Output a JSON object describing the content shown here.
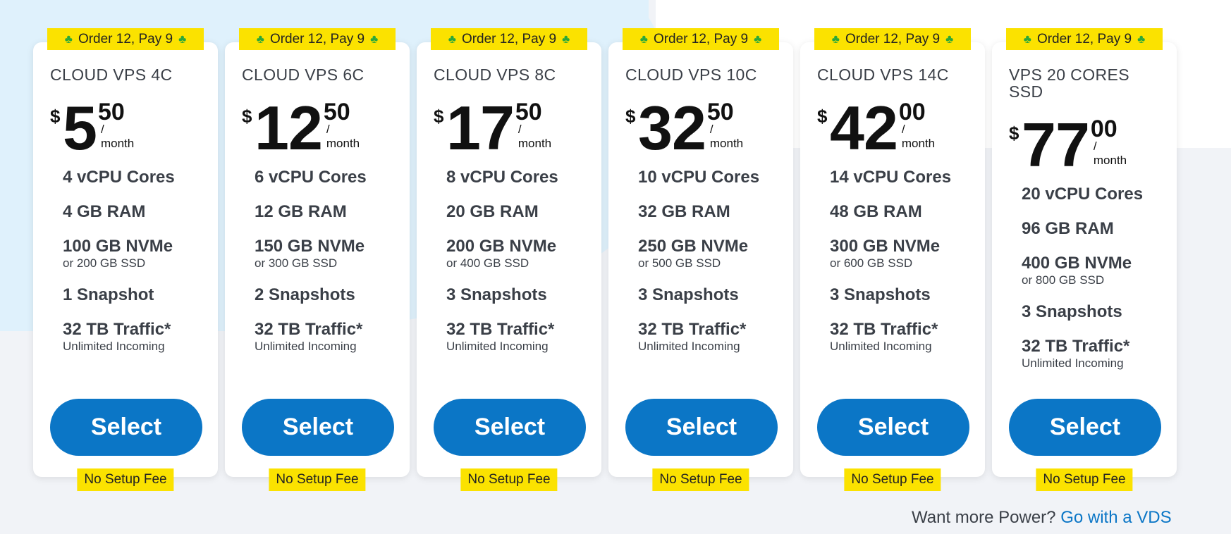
{
  "plans": [
    {
      "promo": "Order 12, Pay 9",
      "name": "CLOUD VPS 4C",
      "currency": "$",
      "price_int": "5",
      "price_frac": "50",
      "period": "/ month",
      "cores": "4 vCPU Cores",
      "ram": "4 GB RAM",
      "storage": "100 GB NVMe",
      "storage_alt": "or 200 GB SSD",
      "snapshots": "1 Snapshot",
      "traffic": "32 TB Traffic*",
      "traffic_note": "Unlimited Incoming",
      "button": "Select",
      "fee": "No Setup Fee"
    },
    {
      "promo": "Order 12, Pay 9",
      "name": "CLOUD VPS 6C",
      "currency": "$",
      "price_int": "12",
      "price_frac": "50",
      "period": "/ month",
      "cores": "6 vCPU Cores",
      "ram": "12 GB RAM",
      "storage": "150 GB NVMe",
      "storage_alt": "or 300 GB SSD",
      "snapshots": "2 Snapshots",
      "traffic": "32 TB Traffic*",
      "traffic_note": "Unlimited Incoming",
      "button": "Select",
      "fee": "No Setup Fee"
    },
    {
      "promo": "Order 12, Pay 9",
      "name": "CLOUD VPS 8C",
      "currency": "$",
      "price_int": "17",
      "price_frac": "50",
      "period": "/ month",
      "cores": "8 vCPU Cores",
      "ram": "20 GB RAM",
      "storage": "200 GB NVMe",
      "storage_alt": "or 400 GB SSD",
      "snapshots": "3 Snapshots",
      "traffic": "32 TB Traffic*",
      "traffic_note": "Unlimited Incoming",
      "button": "Select",
      "fee": "No Setup Fee"
    },
    {
      "promo": "Order 12, Pay 9",
      "name": "CLOUD VPS 10C",
      "currency": "$",
      "price_int": "32",
      "price_frac": "50",
      "period": "/ month",
      "cores": "10 vCPU Cores",
      "ram": "32 GB RAM",
      "storage": "250 GB NVMe",
      "storage_alt": "or 500 GB SSD",
      "snapshots": "3 Snapshots",
      "traffic": "32 TB Traffic*",
      "traffic_note": "Unlimited Incoming",
      "button": "Select",
      "fee": "No Setup Fee"
    },
    {
      "promo": "Order 12, Pay 9",
      "name": "CLOUD VPS 14C",
      "currency": "$",
      "price_int": "42",
      "price_frac": "00",
      "period": "/ month",
      "cores": "14 vCPU Cores",
      "ram": "48 GB RAM",
      "storage": "300 GB NVMe",
      "storage_alt": "or 600 GB SSD",
      "snapshots": "3 Snapshots",
      "traffic": "32 TB Traffic*",
      "traffic_note": "Unlimited Incoming",
      "button": "Select",
      "fee": "No Setup Fee"
    },
    {
      "promo": "Order 12, Pay 9",
      "name": "VPS 20 CORES SSD",
      "currency": "$",
      "price_int": "77",
      "price_frac": "00",
      "period": "/ month",
      "cores": "20 vCPU Cores",
      "ram": "96 GB RAM",
      "storage": "400 GB NVMe",
      "storage_alt": "or 800 GB SSD",
      "snapshots": "3 Snapshots",
      "traffic": "32 TB Traffic*",
      "traffic_note": "Unlimited Incoming",
      "button": "Select",
      "fee": "No Setup Fee"
    }
  ],
  "footer": {
    "text": "Want more Power?",
    "link": "Go with a VDS"
  },
  "colors": {
    "accent": "#0b76c6",
    "badge": "#fbe200",
    "clover": "#2aa83a"
  },
  "icons": {
    "promo": "clover-icon"
  }
}
